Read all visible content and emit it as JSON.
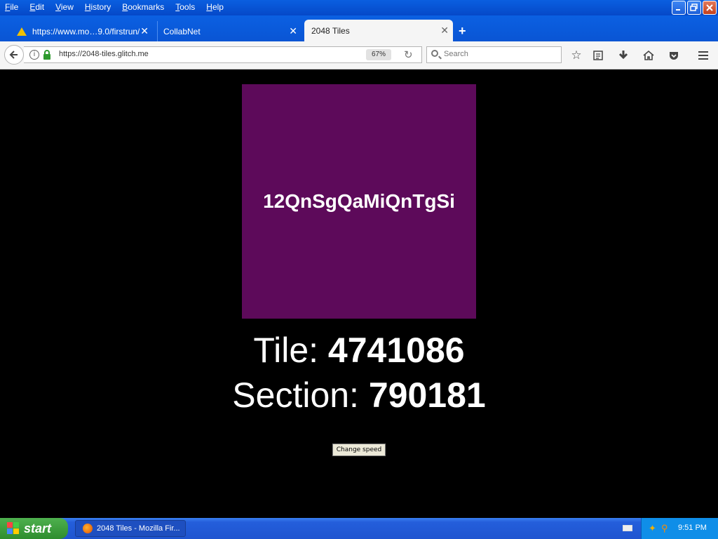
{
  "menu": [
    "File",
    "Edit",
    "View",
    "History",
    "Bookmarks",
    "Tools",
    "Help"
  ],
  "tabs": [
    {
      "label": "https://www.mo…9.0/firstrun/"
    },
    {
      "label": "CollabNet"
    },
    {
      "label": "2048 Tiles"
    }
  ],
  "nav": {
    "url": "https://2048-tiles.glitch.me",
    "zoom": "67%",
    "search_placeholder": "Search"
  },
  "content": {
    "tile_text": "12QnSgQaMiQnTgSi",
    "tile_color": "#5d0a5a",
    "tile_label": "Tile: ",
    "tile_value": "4741086",
    "section_label": "Section: ",
    "section_value": "790181",
    "button_label": "Change speed"
  },
  "taskbar": {
    "start_label": "start",
    "task_item": "2048 Tiles - Mozilla Fir...",
    "clock": "9:51 PM"
  }
}
